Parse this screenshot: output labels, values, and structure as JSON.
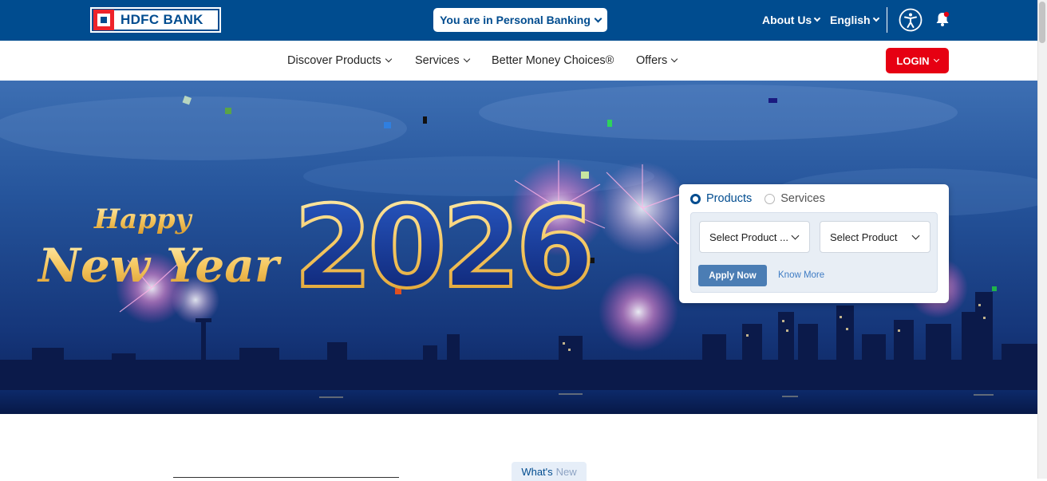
{
  "header": {
    "logo_text": "HDFC BANK",
    "banking_pill": "You are in Personal Banking",
    "about_us": "About Us",
    "language": "English"
  },
  "nav": {
    "items": [
      {
        "label": "Discover Products"
      },
      {
        "label": "Services"
      },
      {
        "label": "Better Money Choices®"
      },
      {
        "label": "Offers"
      }
    ],
    "login": "LOGIN"
  },
  "hero": {
    "greeting_line1": "Happy",
    "greeting_line2": "New Year",
    "year": "2026"
  },
  "widget": {
    "radio_products": "Products",
    "radio_services": "Services",
    "select_category": "Select Product ...",
    "select_product": "Select Product",
    "apply_button": "Apply Now",
    "know_more": "Know More"
  },
  "whats_new": {
    "part1": "What's",
    "part2": "New"
  },
  "colors": {
    "brand_blue": "#004c8f",
    "brand_red": "#e60012",
    "link_blue": "#3f7cc4"
  }
}
